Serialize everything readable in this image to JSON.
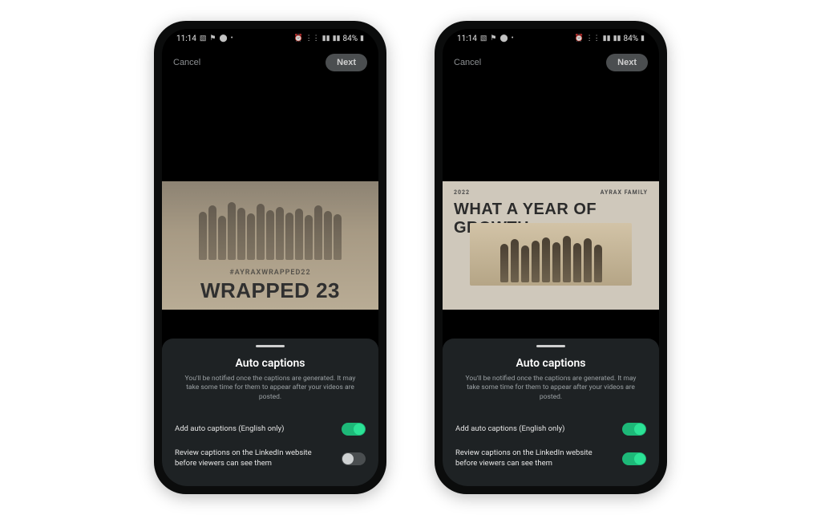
{
  "statusbar": {
    "time": "11:14",
    "battery": "84%"
  },
  "navbar": {
    "cancel": "Cancel",
    "next": "Next"
  },
  "video_left": {
    "hashtag": "#AYRAXWRAPPED22",
    "title": "WRAPPED 23"
  },
  "video_right": {
    "strip_left": "2022",
    "strip_right": "AYRAX FAMILY",
    "title": "WHAT A YEAR OF GROWTH"
  },
  "sheet": {
    "title": "Auto captions",
    "desc": "You'll be notified once the captions are generated. It may take some time for them to appear after your videos are posted.",
    "row1_label": "Add auto captions (English only)",
    "row2_label": "Review captions on the LinkedIn website before viewers can see them"
  },
  "toggles": {
    "left_row1": true,
    "left_row2": false,
    "right_row1": true,
    "right_row2": true
  }
}
